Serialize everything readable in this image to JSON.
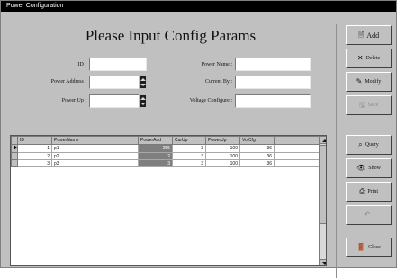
{
  "window": {
    "title": "Power Configuration"
  },
  "heading": "Please Input Config Params",
  "form": {
    "id": {
      "label": "ID :",
      "value": ""
    },
    "power_name": {
      "label": "Power Name :",
      "value": ""
    },
    "power_address": {
      "label": "Power Address :",
      "value": ""
    },
    "current_by": {
      "label": "Current By :",
      "value": ""
    },
    "power_up": {
      "label": "Power Up :",
      "value": ""
    },
    "voltage_configure": {
      "label": "Voltage Configure :",
      "value": ""
    }
  },
  "grid": {
    "columns": [
      "ID",
      "PowerName",
      "PowerAdd",
      "CurUp",
      "PowerUp",
      "VolCfg"
    ],
    "rows": [
      [
        "1",
        "p1",
        "255",
        "3",
        "100",
        "36"
      ],
      [
        "2",
        "p2",
        "2",
        "3",
        "100",
        "36"
      ],
      [
        "3",
        "p3",
        "3",
        "3",
        "100",
        "36"
      ]
    ]
  },
  "buttons": {
    "add": {
      "label": "Add",
      "icon": "add-icon"
    },
    "delete": {
      "label": "Delete",
      "icon": "delete-icon"
    },
    "modify": {
      "label": "Modify",
      "icon": "modify-icon"
    },
    "save": {
      "label": "Save",
      "icon": "save-icon"
    },
    "query": {
      "label": "Query",
      "icon": "query-icon"
    },
    "show": {
      "label": "Show",
      "icon": "binoculars-icon"
    },
    "print": {
      "label": "Print",
      "icon": "printer-icon"
    },
    "cancel": {
      "label": "",
      "icon": "undo-icon"
    },
    "close": {
      "label": "Close",
      "icon": "close-icon"
    }
  }
}
